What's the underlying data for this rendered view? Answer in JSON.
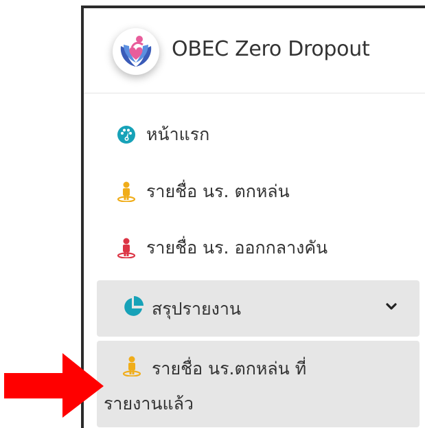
{
  "app": {
    "title": "OBEC Zero Dropout",
    "logo_icon": "heart-hands-logo-icon"
  },
  "nav": {
    "items": [
      {
        "label": "หน้าแรก",
        "icon": "dashboard-gauge-icon",
        "color": "#17a2b8"
      },
      {
        "label": "รายชื่อ นร. ตกหล่น",
        "icon": "person-pin-icon",
        "color": "#f0ad1a"
      },
      {
        "label": "รายชื่อ นร. ออกกลางคัน",
        "icon": "person-pin-icon",
        "color": "#dc3545"
      }
    ],
    "group": {
      "label": "สรุปรายงาน",
      "icon": "pie-chart-icon",
      "color": "#17a2b8",
      "expanded": true,
      "chevron_icon": "chevron-down-icon",
      "children": [
        {
          "label_line1": "รายชื่อ นร.ตกหล่น ที่",
          "label_line2": "รายงานแล้ว",
          "icon": "person-pin-icon",
          "color": "#f0ad1a",
          "active": true
        }
      ]
    }
  },
  "annotation": {
    "icon": "red-arrow-icon",
    "color": "#ff0000"
  }
}
